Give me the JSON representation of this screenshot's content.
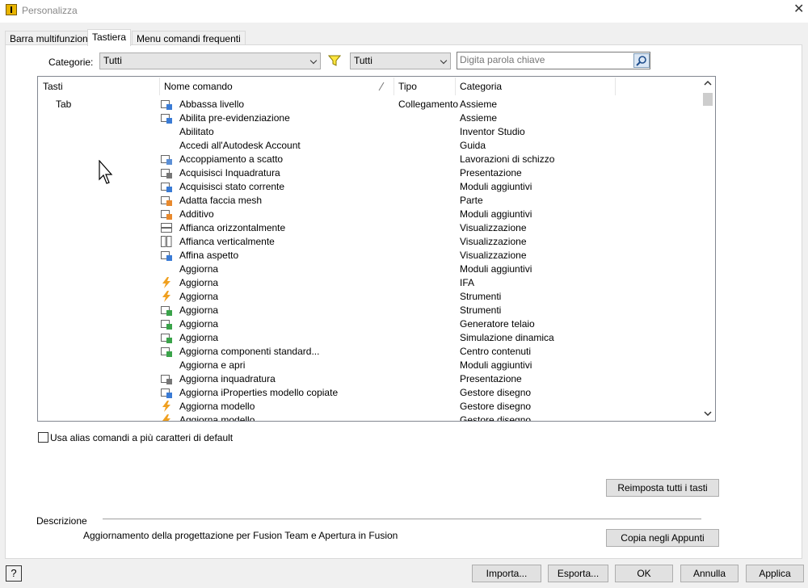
{
  "window": {
    "title": "Personalizza",
    "close_glyph": "✕"
  },
  "tabs": [
    {
      "label": "Barra multifunzione"
    },
    {
      "label": "Tastiera"
    },
    {
      "label": "Menu comandi frequenti"
    }
  ],
  "filters": {
    "category_label": "Categorie:",
    "category_value": "Tutti",
    "type_value": "Tutti",
    "search_placeholder": "Digita parola chiave"
  },
  "grid": {
    "columns": [
      "Tasti",
      "Nome comando",
      "Tipo",
      "Categoria"
    ],
    "rows": [
      {
        "key": "Tab",
        "name": "Abbassa livello",
        "type": "Collegamento",
        "category": "Assieme",
        "icon": "demote-icon",
        "color": "#3a7bd5"
      },
      {
        "key": "",
        "name": "Abilita pre-evidenziazione",
        "type": "",
        "category": "Assieme",
        "icon": "preselect-icon",
        "color": "#3a7bd5"
      },
      {
        "key": "",
        "name": "Abilitato",
        "type": "",
        "category": "Inventor Studio",
        "icon": "",
        "color": ""
      },
      {
        "key": "",
        "name": "Accedi all'Autodesk Account",
        "type": "",
        "category": "Guida",
        "icon": "",
        "color": ""
      },
      {
        "key": "",
        "name": "Accoppiamento a scatto",
        "type": "",
        "category": "Lavorazioni di schizzo",
        "icon": "snap-fit-icon",
        "color": "#5b8fd6"
      },
      {
        "key": "",
        "name": "Acquisisci Inquadratura",
        "type": "",
        "category": "Presentazione",
        "icon": "capture-camera-icon",
        "color": "#777777"
      },
      {
        "key": "",
        "name": "Acquisisci stato corrente",
        "type": "",
        "category": "Moduli aggiuntivi",
        "icon": "capture-state-icon",
        "color": "#3a7bd5"
      },
      {
        "key": "",
        "name": "Adatta faccia mesh",
        "type": "",
        "category": "Parte",
        "icon": "mesh-face-icon",
        "color": "#e8892c"
      },
      {
        "key": "",
        "name": "Additivo",
        "type": "",
        "category": "Moduli aggiuntivi",
        "icon": "additive-icon",
        "color": "#e8892c"
      },
      {
        "key": "",
        "name": "Affianca orizzontalmente",
        "type": "",
        "category": "Visualizzazione",
        "icon": "tile-horizontal-icon",
        "color": "#666666"
      },
      {
        "key": "",
        "name": "Affianca verticalmente",
        "type": "",
        "category": "Visualizzazione",
        "icon": "tile-vertical-icon",
        "color": "#666666"
      },
      {
        "key": "",
        "name": "Affina aspetto",
        "type": "",
        "category": "Visualizzazione",
        "icon": "refine-appearance-icon",
        "color": "#3a7bd5"
      },
      {
        "key": "",
        "name": "Aggiorna",
        "type": "",
        "category": "Moduli aggiuntivi",
        "icon": "",
        "color": ""
      },
      {
        "key": "",
        "name": "Aggiorna",
        "type": "",
        "category": "IFA",
        "icon": "lightning-update-icon",
        "color": "#f0a020"
      },
      {
        "key": "",
        "name": "Aggiorna",
        "type": "",
        "category": "Strumenti",
        "icon": "lightning-update-icon",
        "color": "#f0a020"
      },
      {
        "key": "",
        "name": "Aggiorna",
        "type": "",
        "category": "Strumenti",
        "icon": "document-update-icon",
        "color": "#3aa34a"
      },
      {
        "key": "",
        "name": "Aggiorna",
        "type": "",
        "category": "Generatore telaio",
        "icon": "frame-update-icon",
        "color": "#3aa34a"
      },
      {
        "key": "",
        "name": "Aggiorna",
        "type": "",
        "category": "Simulazione dinamica",
        "icon": "simulation-update-icon",
        "color": "#3aa34a"
      },
      {
        "key": "",
        "name": "Aggiorna componenti standard...",
        "type": "",
        "category": "Centro contenuti",
        "icon": "content-center-update-icon",
        "color": "#3aa34a"
      },
      {
        "key": "",
        "name": "Aggiorna e apri",
        "type": "",
        "category": "Moduli aggiuntivi",
        "icon": "",
        "color": ""
      },
      {
        "key": "",
        "name": "Aggiorna inquadratura",
        "type": "",
        "category": "Presentazione",
        "icon": "camera-update-icon",
        "color": "#777777"
      },
      {
        "key": "",
        "name": "Aggiorna iProperties modello copiate",
        "type": "",
        "category": "Gestore disegno",
        "icon": "iproperties-update-icon",
        "color": "#3a7bd5"
      },
      {
        "key": "",
        "name": "Aggiorna modello",
        "type": "",
        "category": "Gestore disegno",
        "icon": "lightning-update-icon",
        "color": "#f0a020"
      },
      {
        "key": "",
        "name": "Aggiorna modello",
        "type": "",
        "category": "Gestore disegno",
        "icon": "lightning-update-icon",
        "color": "#f0a020"
      }
    ]
  },
  "options": {
    "alias_checkbox_label": "Usa alias comandi a più caratteri di default"
  },
  "buttons": {
    "reset_all": "Reimposta tutti i tasti",
    "copy_clipboard": "Copia negli Appunti",
    "import": "Importa...",
    "export": "Esporta...",
    "ok": "OK",
    "cancel": "Annulla",
    "apply": "Applica",
    "help": "?"
  },
  "description": {
    "label": "Descrizione",
    "text": "Aggiornamento della progettazione per Fusion Team e Apertura in Fusion"
  }
}
